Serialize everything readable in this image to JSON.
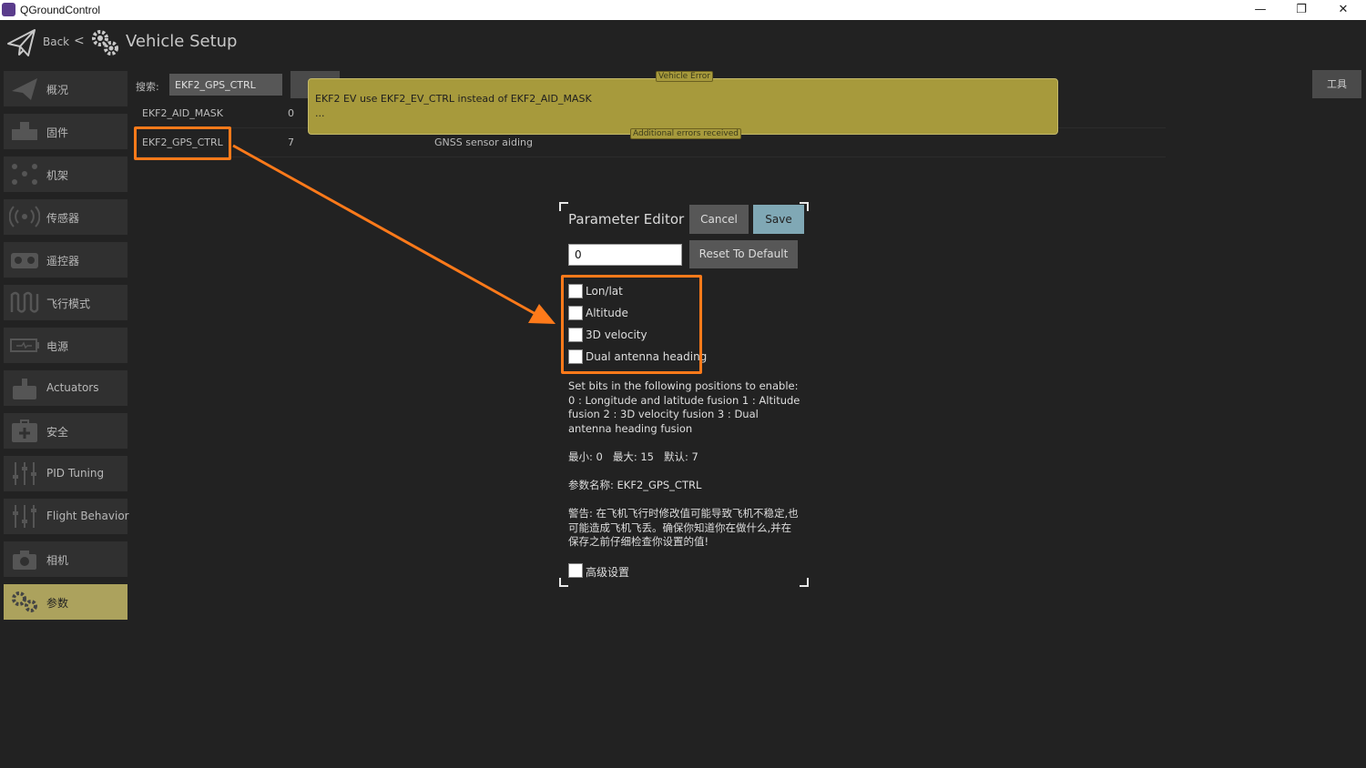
{
  "window": {
    "app_title": "QGroundControl",
    "minimize_glyph": "—",
    "restore_glyph": "❐",
    "close_glyph": "✕"
  },
  "header": {
    "back_label": "Back",
    "back_chevron": "<",
    "title": "Vehicle Setup"
  },
  "sidebar": {
    "items": [
      {
        "label": "概况",
        "icon": "plane-icon",
        "active": false
      },
      {
        "label": "固件",
        "icon": "firmware-icon",
        "active": false
      },
      {
        "label": "机架",
        "icon": "airframe-icon",
        "active": false
      },
      {
        "label": "传感器",
        "icon": "sensors-icon",
        "active": false
      },
      {
        "label": "遥控器",
        "icon": "radio-icon",
        "active": false
      },
      {
        "label": "飞行模式",
        "icon": "flight-modes-icon",
        "active": false
      },
      {
        "label": "电源",
        "icon": "battery-icon",
        "active": false
      },
      {
        "label": "Actuators",
        "icon": "actuators-icon",
        "active": false
      },
      {
        "label": "安全",
        "icon": "safety-icon",
        "active": false
      },
      {
        "label": "PID Tuning",
        "icon": "tuning-icon",
        "active": false
      },
      {
        "label": "Flight Behavior",
        "icon": "flight-behavior-icon",
        "active": false
      },
      {
        "label": "相机",
        "icon": "camera-icon",
        "active": false
      },
      {
        "label": "参数",
        "icon": "gears-icon",
        "active": true
      }
    ]
  },
  "search": {
    "label": "搜索:",
    "value": "EKF2_GPS_CTRL"
  },
  "params": {
    "rows": [
      {
        "name": "EKF2_AID_MASK",
        "value": "0",
        "description": ""
      },
      {
        "name": "EKF2_GPS_CTRL",
        "value": "7",
        "description": "GNSS sensor aiding"
      }
    ]
  },
  "vehicle_error": {
    "tag": "Vehicle Error",
    "message": "EKF2 EV use EKF2_EV_CTRL instead of EKF2_AID_MASK",
    "more": "...",
    "footer_tag": "Additional errors received"
  },
  "tools_button": {
    "label": "工具"
  },
  "editor": {
    "title": "Parameter Editor",
    "cancel_label": "Cancel",
    "save_label": "Save",
    "value": "0",
    "reset_label": "Reset To Default",
    "bits": [
      {
        "label": "Lon/lat",
        "checked": false
      },
      {
        "label": "Altitude",
        "checked": false
      },
      {
        "label": "3D velocity",
        "checked": false
      },
      {
        "label": "Dual antenna heading",
        "checked": false
      }
    ],
    "description": "Set bits in the following positions to enable: 0 : Longitude and latitude fusion 1 : Altitude fusion 2 : 3D velocity fusion 3 : Dual antenna heading fusion",
    "range": "最小: 0   最大: 15   默认: 7",
    "param_name": "参数名称: EKF2_GPS_CTRL",
    "warning": "警告: 在飞机飞行时修改值可能导致飞机不稳定,也可能造成飞机飞丢。确保你知道你在做什么,并在保存之前仔细检查你设置的值!",
    "advanced_label": "高级设置"
  },
  "colors": {
    "background": "#222222",
    "sidebar_item": "#303030",
    "sidebar_active": "#aca25d",
    "error_banner": "#a79a3c",
    "highlight": "#ff7a1a",
    "save_button": "#80a8b5"
  }
}
